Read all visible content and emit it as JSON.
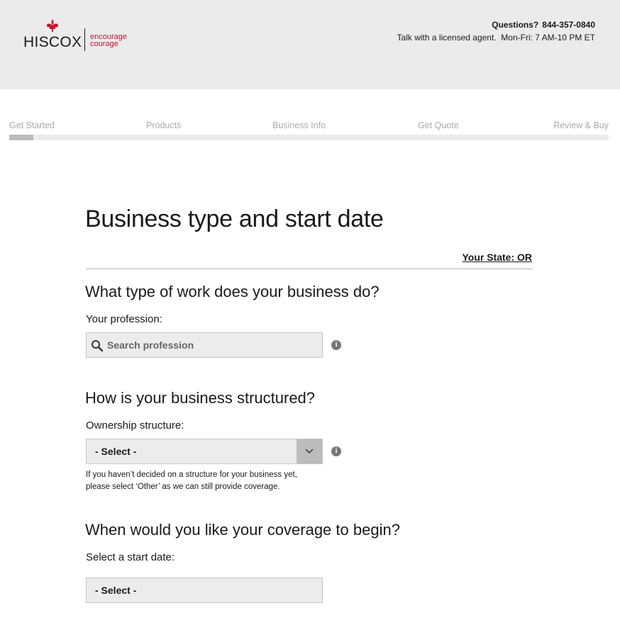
{
  "header": {
    "brand": "HISCOX",
    "tagline_line1": "encourage",
    "tagline_line2": "courage",
    "questions_label": "Questions?",
    "phone": "844-357-0840",
    "hours": "Talk with a licensed agent.  Mon-Fri: 7 AM-10 PM ET",
    "brand_color": "#c8102e"
  },
  "steps": [
    "Get Started",
    "Products",
    "Business Info",
    "Get Quote",
    "Review & Buy"
  ],
  "progress": {
    "fraction": 0.04
  },
  "main": {
    "title": "Business type and start date",
    "state_link": "Your State: OR",
    "q1": {
      "heading": "What type of work does your business do?",
      "label": "Your profession:",
      "placeholder": "Search profession"
    },
    "q2": {
      "heading": "How is your business structured?",
      "label": "Ownership structure:",
      "selected": "- Select -",
      "help_line1": "If you haven’t decided on a structure for your business yet,",
      "help_line2": "please select ‘Other’ as we can still provide coverage."
    },
    "q3": {
      "heading": "When would you like your coverage to begin?",
      "label": "Select a start date:",
      "selected": "- Select -"
    }
  },
  "icons": {
    "search": "search-icon",
    "info": "info-icon",
    "chevron": "chevron-down-icon",
    "logo_mark": "fleur-de-lis-icon"
  }
}
